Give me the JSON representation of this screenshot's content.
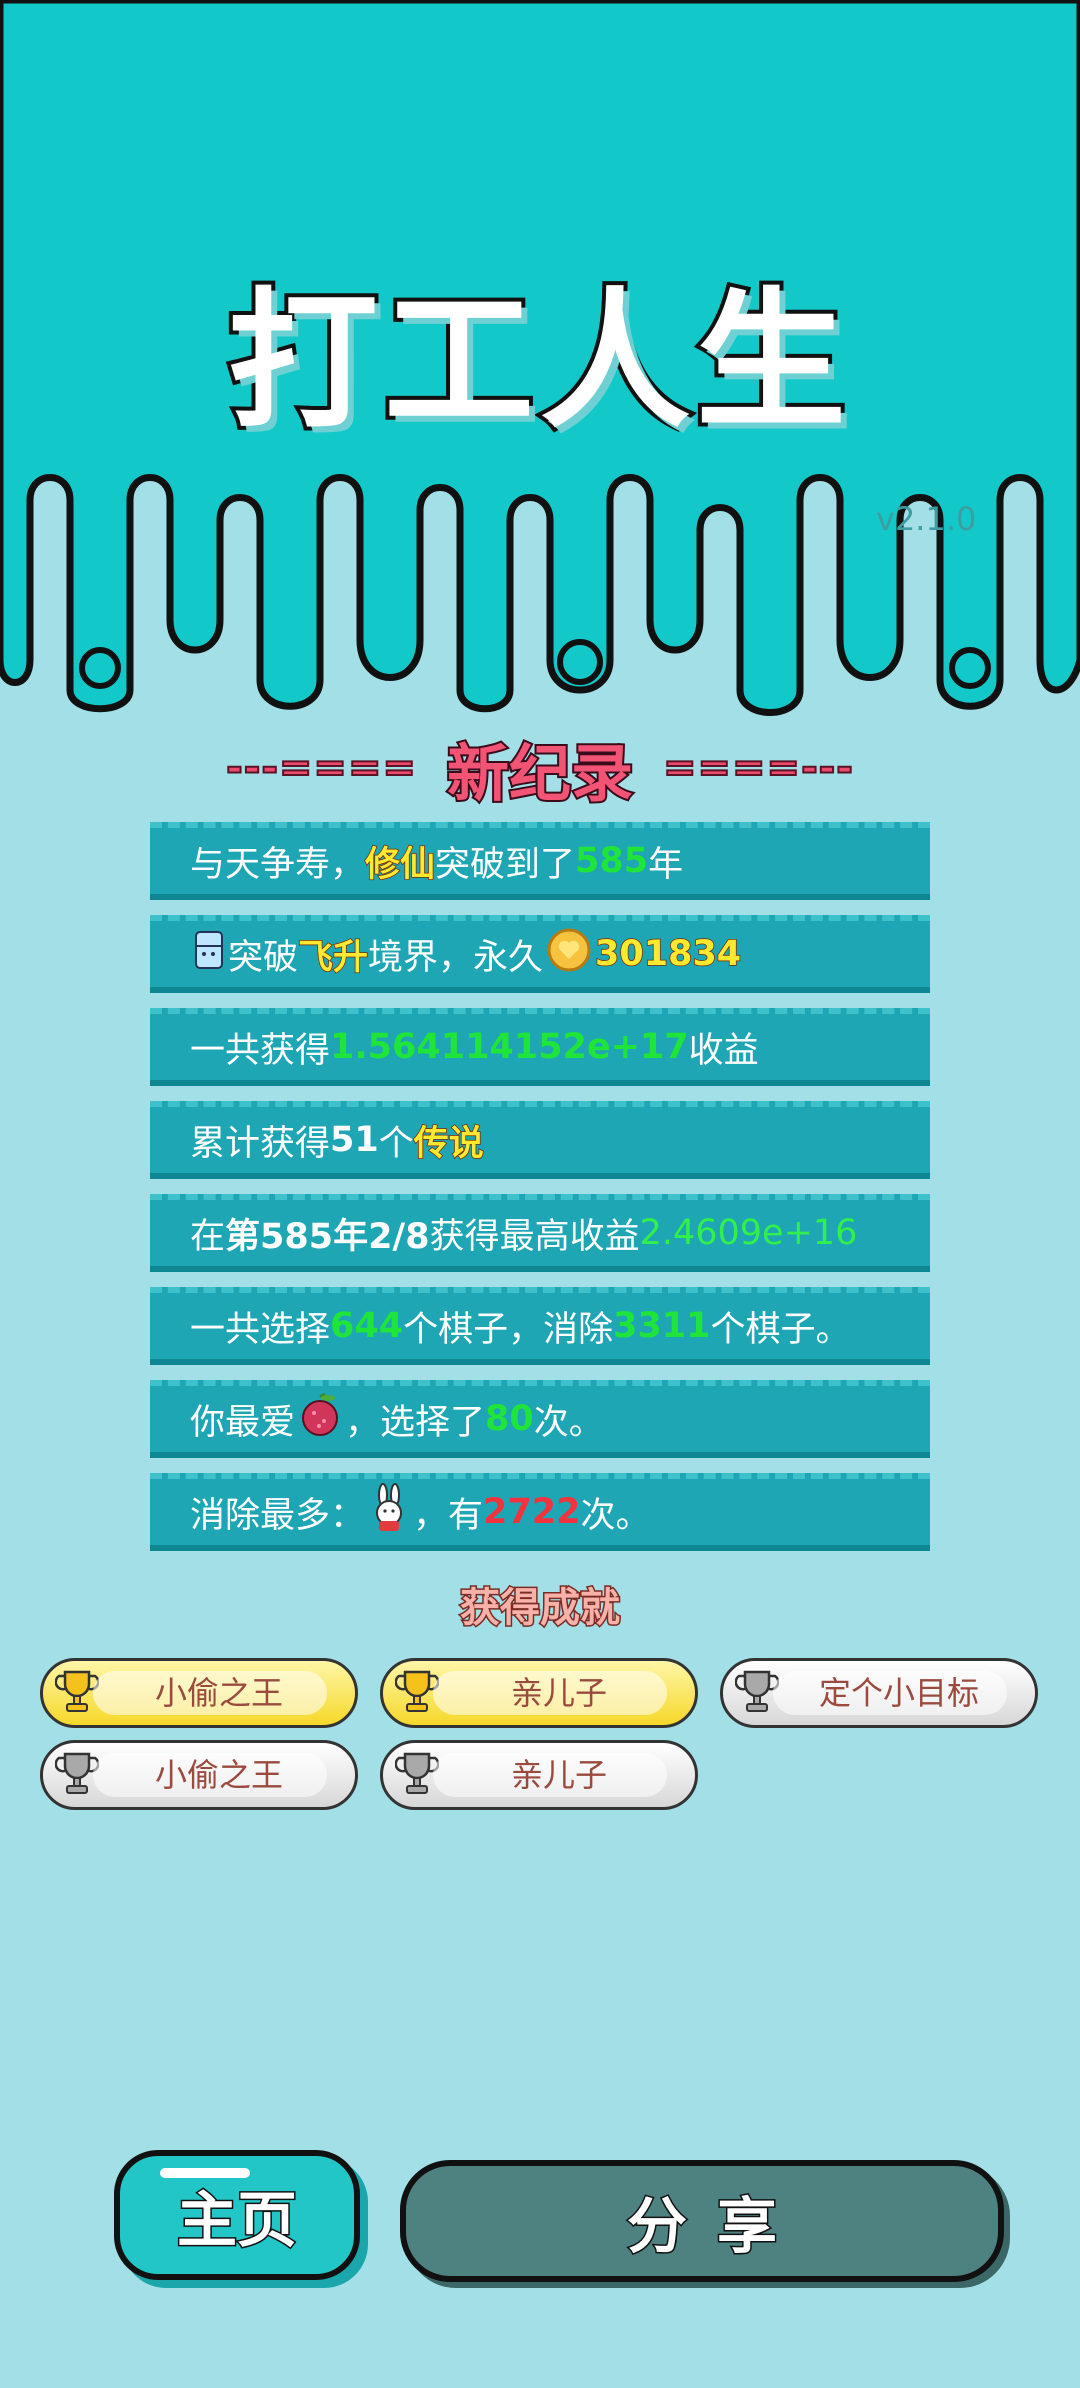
{
  "game": {
    "title": "打工人生",
    "version": "v2.1.0"
  },
  "record": {
    "heading": "新纪录",
    "left_decor": "---====",
    "right_decor": "====---"
  },
  "records": [
    {
      "parts": [
        "与天争寿，",
        "修仙",
        "突破到了",
        "585",
        "年"
      ]
    },
    {
      "parts": [
        "突破",
        "飞升",
        "境界，永久",
        "301834"
      ]
    },
    {
      "parts": [
        "一共获得",
        "1.564114152e+17",
        "收益"
      ]
    },
    {
      "parts": [
        "累计获得",
        "51",
        "个",
        "传说"
      ]
    },
    {
      "parts": [
        "在 ",
        "第585年2/8",
        " 获得最高收益",
        "2.4609e+16"
      ]
    },
    {
      "parts": [
        "一共选择",
        "644",
        "个棋子，消除",
        "3311",
        "个棋子。"
      ]
    },
    {
      "parts": [
        "你最爱",
        "，选择了",
        "80",
        "次。"
      ]
    },
    {
      "parts": [
        "消除最多：",
        "，有",
        "2722",
        "次。"
      ]
    }
  ],
  "achievements": {
    "title": "获得成就",
    "items": [
      {
        "label": "小偷之王",
        "tier": "gold"
      },
      {
        "label": "亲儿子",
        "tier": "gold"
      },
      {
        "label": "定个小目标",
        "tier": "silver"
      },
      {
        "label": "小偷之王",
        "tier": "silver"
      },
      {
        "label": "亲儿子",
        "tier": "silver"
      }
    ]
  },
  "buttons": {
    "home": "主页",
    "share": "分享"
  },
  "colors": {
    "top_band": "#13c8c8",
    "page_bg": "#a3dfe6",
    "row_bg": "#1ea6b5",
    "accent_red": "#f25476"
  }
}
